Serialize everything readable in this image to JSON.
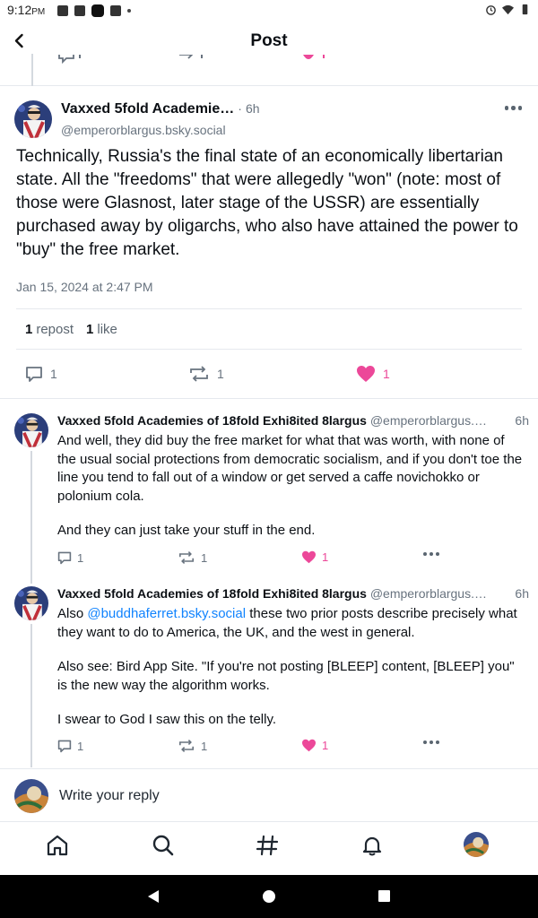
{
  "status_bar": {
    "time": "9:12",
    "ampm": "PM"
  },
  "header": {
    "title": "Post"
  },
  "main_post": {
    "author_name": "Vaxxed 5fold Academie…",
    "time_sep": "·",
    "time": "6h",
    "handle": "@emperorblargus.bsky.social",
    "text": "Technically, Russia's the final state of an economically libertarian state. All the \"freedoms\" that were allegedly \"won\" (note: most of those were Glasnost, later stage of the USSR) are essentially purchased away by oligarchs, who also have attained the power to \"buy\" the free market.",
    "date": "Jan 15, 2024 at 2:47 PM",
    "stats": {
      "repost_count": "1",
      "repost_label": "repost",
      "like_count": "1",
      "like_label": "like"
    },
    "actions": {
      "reply_count": "1",
      "repost_count": "1",
      "like_count": "1"
    }
  },
  "replies": [
    {
      "author_name": "Vaxxed 5fold Academies of 18fold Exhi8ited 8largus",
      "handle": "@emperorblargus.…",
      "time": "6h",
      "paragraphs": [
        "And well, they did buy the free market for what that was worth, with none of the usual social protections from democratic socialism, and if you don't toe the line you tend to fall out of a window or get served a caffe novichokko or polonium cola.",
        "And they can just take your stuff in the end."
      ],
      "actions": {
        "reply_count": "1",
        "repost_count": "1",
        "like_count": "1"
      }
    },
    {
      "author_name": "Vaxxed 5fold Academies of 18fold Exhi8ited 8largus",
      "handle": "@emperorblargus.…",
      "time": "6h",
      "p1_prefix": "Also ",
      "p1_mention": "@buddhaferret.bsky.social",
      "p1_suffix": " these two prior posts describe precisely what they want to do to America, the UK, and the west in general.",
      "p2": "Also see: Bird App Site. \"If you're not posting [BLEEP] content, [BLEEP] you\" is the new way the algorithm works.",
      "p3": "I swear to God I saw this on the telly.",
      "actions": {
        "reply_count": "1",
        "repost_count": "1",
        "like_count": "1"
      }
    }
  ],
  "composer": {
    "placeholder": "Write your reply"
  },
  "colors": {
    "accent": "#1083fe",
    "like": "#ec4899",
    "muted": "#68737f"
  },
  "icons": [
    "back-arrow-icon",
    "reply-icon",
    "repost-icon",
    "heart-icon",
    "more-icon",
    "home-icon",
    "search-icon",
    "hashtag-icon",
    "bell-icon"
  ]
}
